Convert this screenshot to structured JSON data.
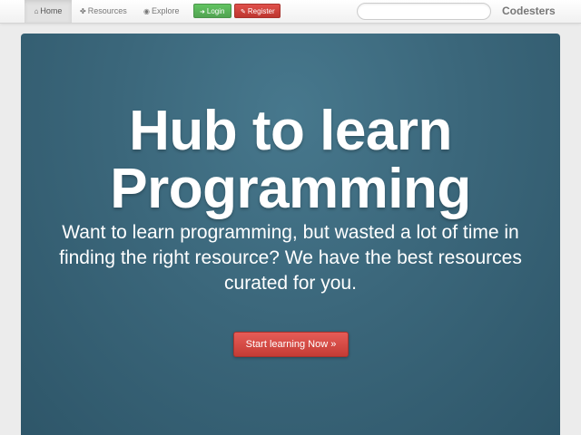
{
  "navbar": {
    "items": [
      {
        "label": "Home",
        "icon": "home-icon",
        "active": true
      },
      {
        "label": "Resources",
        "icon": "pin-icon",
        "active": false
      },
      {
        "label": "Explore",
        "icon": "globe-icon",
        "active": false
      }
    ],
    "login_label": "Login",
    "register_label": "Register",
    "search": {
      "value": "",
      "placeholder": ""
    },
    "brand": "Codesters"
  },
  "hero": {
    "title_line1": "Hub to learn",
    "title_line2": "Programming",
    "subtitle": "Want to learn programming, but wasted a lot of time in finding the right resource? We have the best resources curated for you.",
    "cta_label": "Start learning Now »"
  },
  "colors": {
    "hero_background": "#3b677b",
    "login_green": "#51a351",
    "register_red": "#bd362f",
    "cta_red": "#c43c35"
  }
}
